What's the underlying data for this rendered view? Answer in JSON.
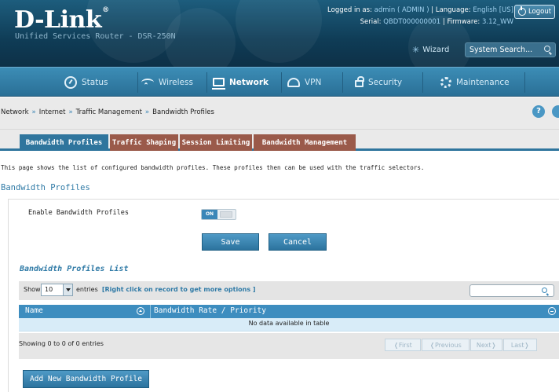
{
  "brand": {
    "logo": "D-Link",
    "model": "Unified Services Router - DSR-250N"
  },
  "header": {
    "logged_in_label": "Logged in as:",
    "logged_in_user": "admin ( ADMIN )",
    "language_label": "Language:",
    "language_value": "English [US]",
    "serial_label": "Serial:",
    "serial_value": "QBDT000000001",
    "firmware_label": "Firmware:",
    "firmware_value": "3.12_WW",
    "logout_label": "Logout",
    "wizard_label": "Wizard",
    "search_placeholder": "System Search..."
  },
  "nav": {
    "items": [
      {
        "label": "Status",
        "icon": "dashboard-icon"
      },
      {
        "label": "Wireless",
        "icon": "wifi-icon"
      },
      {
        "label": "Network",
        "icon": "monitor-icon"
      },
      {
        "label": "VPN",
        "icon": "cloud-icon"
      },
      {
        "label": "Security",
        "icon": "lock-icon"
      },
      {
        "label": "Maintenance",
        "icon": "gears-icon"
      }
    ],
    "active": "Network"
  },
  "breadcrumb": {
    "items": [
      "Network",
      "Internet",
      "Traffic Management",
      "Bandwidth Profiles"
    ],
    "separator": "»"
  },
  "tabs": {
    "items": [
      "Bandwidth Profiles",
      "Traffic Shaping",
      "Session Limiting",
      "Bandwidth Management"
    ],
    "active": "Bandwidth Profiles"
  },
  "page": {
    "description": "This page shows the list of configured bandwidth profiles. These profiles then can be used with the traffic selectors.",
    "section_title": "Bandwidth Profiles",
    "enable_label": "Enable Bandwidth Profiles",
    "toggle_state": "ON",
    "save_label": "Save",
    "cancel_label": "Cancel"
  },
  "list": {
    "title": "Bandwidth Profiles List",
    "show_label": "Show",
    "page_size": "10",
    "entries_label": "entries",
    "hint": "[Right click on record to get more options ]",
    "columns": [
      "Name",
      "Bandwidth Rate / Priority"
    ],
    "empty_message": "No data available in table",
    "showing": "Showing 0 to 0 of 0 entries",
    "pager": {
      "first": "First",
      "previous": "Previous",
      "next": "Next",
      "last": "Last"
    },
    "add_label": "Add New Bandwidth Profile"
  },
  "colors": {
    "header_dark": "#0f3c56",
    "nav": "#2f759d",
    "accent": "#3d8dbf",
    "tab_inactive": "#9a5a4a"
  }
}
